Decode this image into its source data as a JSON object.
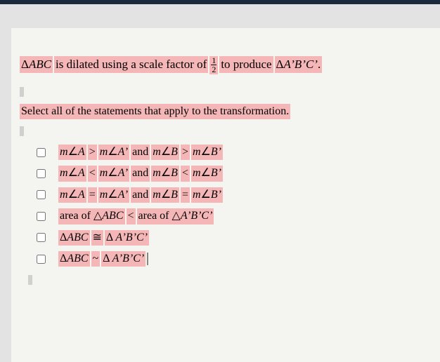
{
  "question": {
    "pre": "",
    "abc": "ABC",
    "mid1": " is dilated using a scale factor of ",
    "frac_num": "1",
    "frac_den": "2",
    "mid2": " to produce ",
    "abc2": "A’B’C’",
    "end": "."
  },
  "prompt": "Select all of the statements that apply to the transformation.",
  "options": {
    "o1": {
      "a": "A",
      "rel1": ">",
      "a2": "A’",
      "and": " and ",
      "b": "B",
      "rel2": ">",
      "b2": "B’"
    },
    "o2": {
      "a": "A",
      "rel1": "<",
      "a2": "A’",
      "and": " and ",
      "b": "B",
      "rel2": "<",
      "b2": "B’"
    },
    "o3": {
      "a": "A",
      "rel1": "=",
      "a2": "A’",
      "and": " and ",
      "b": "B",
      "rel2": "=",
      "b2": "B’"
    },
    "o4": {
      "t1": "area of ",
      "abc": "ABC",
      "rel": "<",
      "t2": " area of ",
      "abc2": "A’B’C’"
    },
    "o5": {
      "abc": "ABC",
      "rel": "≅",
      "abc2": "A’B’C’"
    },
    "o6": {
      "abc": "ABC",
      "rel": "~",
      "abc2": "A’B’C’"
    }
  }
}
